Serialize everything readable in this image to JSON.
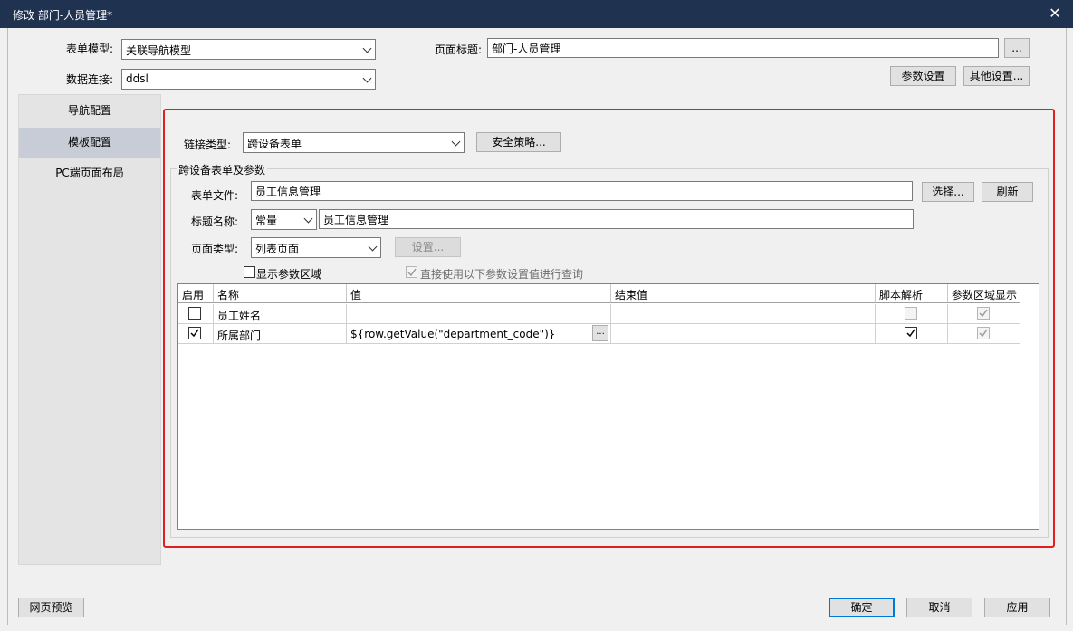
{
  "window": {
    "title": "修改 部门-人员管理*"
  },
  "header": {
    "form_model_label": "表单模型:",
    "form_model_value": "关联导航模型",
    "data_conn_label": "数据连接:",
    "data_conn_value": "ddsl",
    "page_title_label": "页面标题:",
    "page_title_value": "部门-人员管理",
    "page_title_more": "...",
    "param_settings": "参数设置",
    "other_settings": "其他设置..."
  },
  "sidebar": {
    "items": [
      {
        "label": "导航配置"
      },
      {
        "label": "模板配置"
      },
      {
        "label": "PC端页面布局"
      }
    ]
  },
  "link": {
    "type_label": "链接类型:",
    "type_value": "跨设备表单",
    "security_button": "安全策略..."
  },
  "group": {
    "title": "跨设备表单及参数",
    "form_file_label": "表单文件:",
    "form_file_value": "员工信息管理",
    "select_button": "选择...",
    "refresh_button": "刷新",
    "title_name_label": "标题名称:",
    "title_mode_value": "常量",
    "title_name_value": "员工信息管理",
    "page_type_label": "页面类型:",
    "page_type_value": "列表页面",
    "settings_button": "设置...",
    "show_param_area": "显示参数区域",
    "use_params_query": "直接使用以下参数设置值进行查询"
  },
  "grid": {
    "headers": [
      "启用",
      "名称",
      "值",
      "结束值",
      "脚本解析",
      "参数区域显示"
    ],
    "rows": [
      {
        "enabled": false,
        "name": "员工姓名",
        "value": "",
        "end_value": "",
        "script": false,
        "show": true
      },
      {
        "enabled": true,
        "name": "所属部门",
        "value": "${row.getValue(\"department_code\")}",
        "end_value": "",
        "script": true,
        "show": true
      }
    ],
    "cell_more": "..."
  },
  "footer": {
    "preview": "网页预览",
    "ok": "确定",
    "cancel": "取消",
    "apply": "应用"
  }
}
